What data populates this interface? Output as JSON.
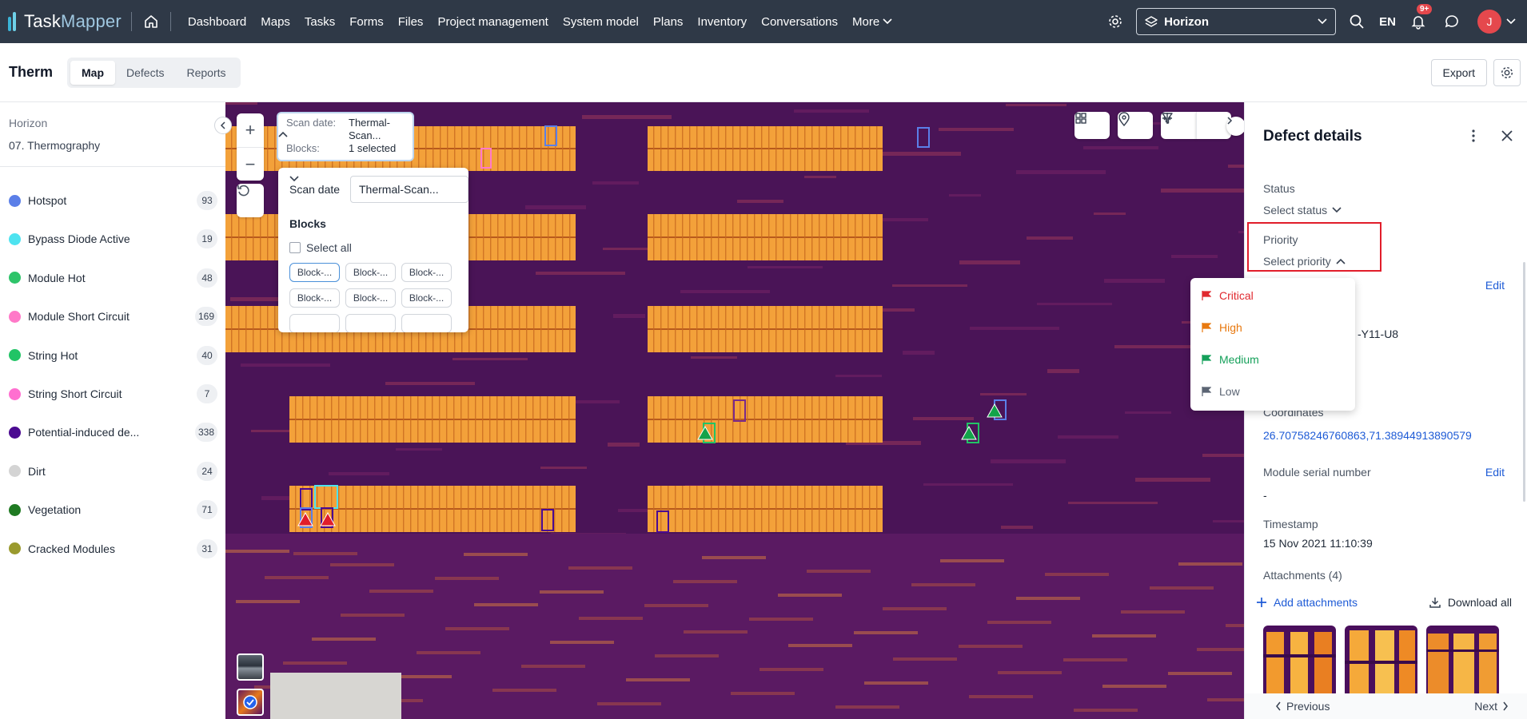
{
  "topnav": {
    "logo": {
      "part1": "Task",
      "part2": "Mapper"
    },
    "links": [
      "Dashboard",
      "Maps",
      "Tasks",
      "Forms",
      "Files",
      "Project management",
      "System model",
      "Plans",
      "Inventory",
      "Conversations"
    ],
    "more_label": "More",
    "workspace": "Horizon",
    "language": "EN",
    "notifications_badge": "9+",
    "avatar_initial": "J"
  },
  "subheader": {
    "title": "Therm",
    "tabs": [
      "Map",
      "Defects",
      "Reports"
    ],
    "active_tab": "Map",
    "export_label": "Export"
  },
  "sidebar": {
    "breadcrumb_project": "Horizon",
    "breadcrumb_folder": "07. Thermography",
    "defects": [
      {
        "label": "Hotspot",
        "count": "93",
        "color": "#5b7fe8"
      },
      {
        "label": "Bypass Diode Active",
        "count": "19",
        "color": "#4ee3f0"
      },
      {
        "label": "Module Hot",
        "count": "48",
        "color": "#2ec46a"
      },
      {
        "label": "Module Short Circuit",
        "count": "169",
        "color": "#ff79c8"
      },
      {
        "label": "String Hot",
        "count": "40",
        "color": "#22c466"
      },
      {
        "label": "String Short Circuit",
        "count": "7",
        "color": "#ff6fd0"
      },
      {
        "label": "Potential-induced de...",
        "count": "338",
        "color": "#4b0a91"
      },
      {
        "label": "Dirt",
        "count": "24",
        "color": "#d4d4d4"
      },
      {
        "label": "Vegetation",
        "count": "71",
        "color": "#1f7a22"
      },
      {
        "label": "Cracked Modules",
        "count": "31",
        "color": "#9a9a2e"
      }
    ]
  },
  "map": {
    "scan_box": {
      "scan_date_key": "Scan date:",
      "scan_date_value": "Thermal-Scan...",
      "blocks_key": "Blocks:",
      "blocks_value": "1 selected"
    },
    "scan_panel": {
      "scan_date_label": "Scan date",
      "scan_date_value": "Thermal-Scan...",
      "blocks_title": "Blocks",
      "select_all": "Select all",
      "chips": [
        "Block-...",
        "Block-...",
        "Block-...",
        "Block-...",
        "Block-...",
        "Block-..."
      ]
    }
  },
  "details": {
    "title": "Defect details",
    "status_label": "Status",
    "status_placeholder": "Select status",
    "priority_label": "Priority",
    "priority_placeholder": "Select priority",
    "edit_label": "Edit",
    "partial_id": "-Y11-U8",
    "coordinates_label": "Coordinates",
    "coordinates_value": "26.70758246760863,71.38944913890579",
    "serial_label": "Module serial number",
    "serial_value": "-",
    "timestamp_label": "Timestamp",
    "timestamp_value": "15 Nov 2021 11:10:39",
    "attachments_label": "Attachments (4)",
    "add_attachments": "Add attachments",
    "download_all": "Download all",
    "previous": "Previous",
    "next": "Next"
  },
  "priority_menu": [
    {
      "label": "Critical",
      "color": "#e0292f"
    },
    {
      "label": "High",
      "color": "#e8790f"
    },
    {
      "label": "Medium",
      "color": "#15a05a"
    },
    {
      "label": "Low",
      "color": "#5b6473"
    }
  ]
}
